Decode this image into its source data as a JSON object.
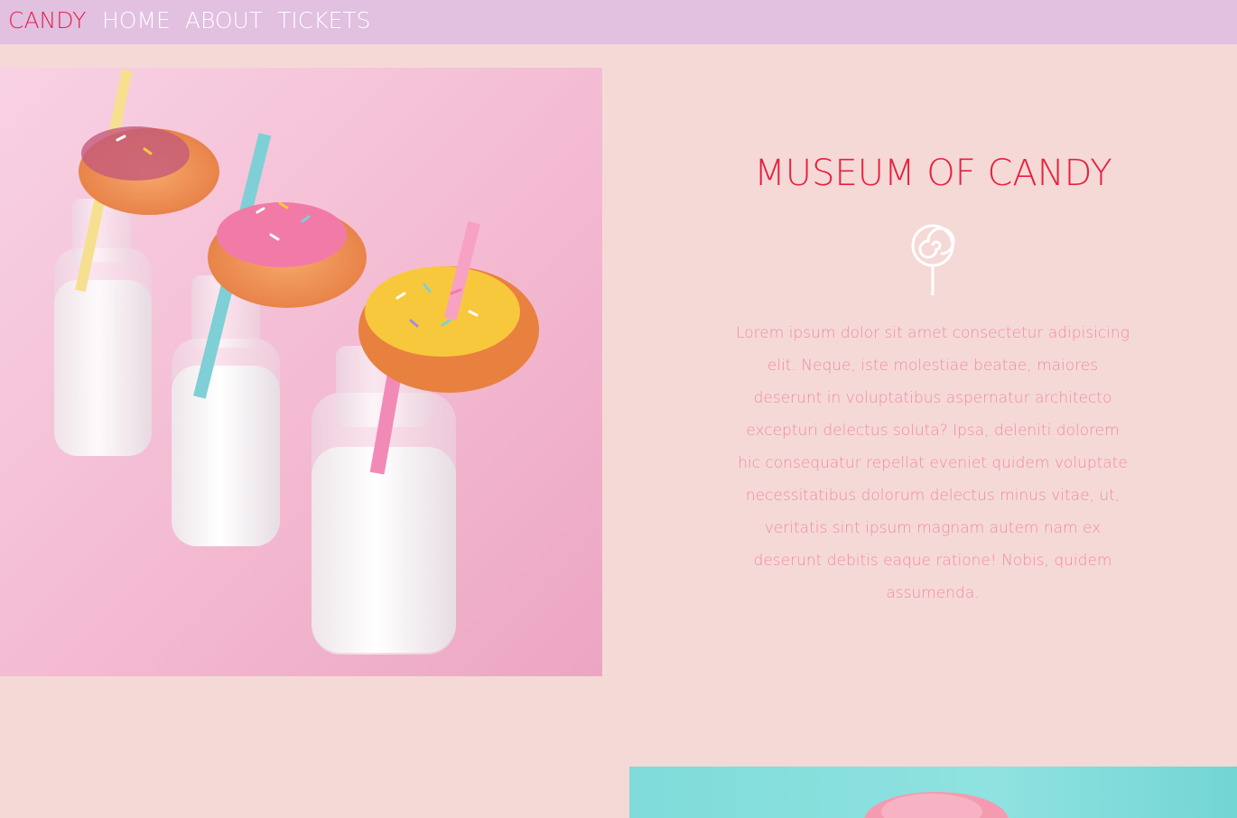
{
  "nav": {
    "brand": "CANDY",
    "links": [
      {
        "label": "HOME"
      },
      {
        "label": "ABOUT"
      },
      {
        "label": "TICKETS"
      }
    ]
  },
  "hero": {
    "title": "MUSEUM OF CANDY",
    "icon": "lollipop-icon",
    "body": "Lorem ipsum dolor sit amet consectetur adipisicing elit. Neque, iste molestiae beatae, maiores deserunt in voluptatibus aspernatur architecto excepturi delectus soluta? Ipsa, deleniti dolorem hic consequatur repellat eveniet quidem voluptate necessitatibus dolorum delectus minus vitae, ut, veritatis sint ipsum magnam autem nam ex deserunt debitis eaque ratione! Nobis, quidem assumenda."
  },
  "colors": {
    "page_bg": "#f5d9d6",
    "navbar_bg": "#e1c0e0",
    "brand": "#e8204a",
    "title": "#e8203e",
    "body_text": "#ef8aac",
    "nav_link": "#ffffff"
  }
}
